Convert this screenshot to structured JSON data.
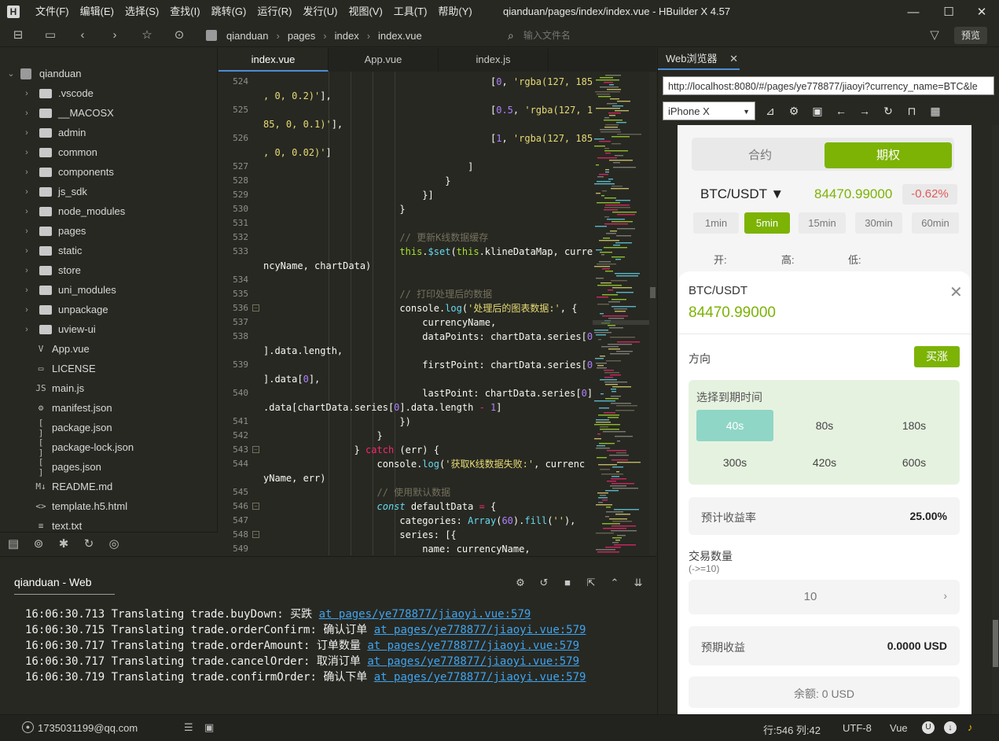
{
  "app": {
    "logo": "H",
    "title": "qianduan/pages/index/index.vue - HBuilder X 4.57",
    "menu": [
      "文件(F)",
      "编辑(E)",
      "选择(S)",
      "查找(I)",
      "跳转(G)",
      "运行(R)",
      "发行(U)",
      "视图(V)",
      "工具(T)",
      "帮助(Y)"
    ]
  },
  "toolbar": {
    "breadcrumb": [
      "qianduan",
      "pages",
      "index",
      "index.vue"
    ],
    "file_search_placeholder": "输入文件名",
    "preview_label": "预览"
  },
  "sidebar": {
    "project": "qianduan",
    "items": [
      {
        "label": ".vscode",
        "type": "folder"
      },
      {
        "label": "__MACOSX",
        "type": "folder"
      },
      {
        "label": "admin",
        "type": "folder"
      },
      {
        "label": "common",
        "type": "folder"
      },
      {
        "label": "components",
        "type": "folder"
      },
      {
        "label": "js_sdk",
        "type": "folder"
      },
      {
        "label": "node_modules",
        "type": "folder"
      },
      {
        "label": "pages",
        "type": "folder"
      },
      {
        "label": "static",
        "type": "folder"
      },
      {
        "label": "store",
        "type": "folder"
      },
      {
        "label": "uni_modules",
        "type": "folder"
      },
      {
        "label": "unpackage",
        "type": "folder"
      },
      {
        "label": "uview-ui",
        "type": "folder"
      },
      {
        "label": "App.vue",
        "type": "file",
        "icon": "V"
      },
      {
        "label": "LICENSE",
        "type": "file",
        "icon": "▭"
      },
      {
        "label": "main.js",
        "type": "file",
        "icon": "JS"
      },
      {
        "label": "manifest.json",
        "type": "file",
        "icon": "⚙"
      },
      {
        "label": "package.json",
        "type": "file",
        "icon": "[ ]"
      },
      {
        "label": "package-lock.json",
        "type": "file",
        "icon": "[ ]"
      },
      {
        "label": "pages.json",
        "type": "file",
        "icon": "[ ]"
      },
      {
        "label": "README.md",
        "type": "file",
        "icon": "M↓"
      },
      {
        "label": "template.h5.html",
        "type": "file",
        "icon": "<>"
      },
      {
        "label": "text.txt",
        "type": "file",
        "icon": "≡"
      }
    ]
  },
  "editor": {
    "tabs": [
      "index.vue",
      "App.vue",
      "index.js"
    ],
    "lines": [
      {
        "n": "524",
        "html": "                                        [<span class=\"n\">0</span>, <span class=\"s\">'rgba(127, 185</span>"
      },
      {
        "n": "",
        "html": "<span class=\"s\">, 0, 0.2)'</span>],"
      },
      {
        "n": "525",
        "html": "                                        [<span class=\"n\">0.5</span>, <span class=\"s\">'rgba(127, 1</span>"
      },
      {
        "n": "",
        "html": "<span class=\"s\">85, 0, 0.1)'</span>],"
      },
      {
        "n": "526",
        "html": "                                        [<span class=\"n\">1</span>, <span class=\"s\">'rgba(127, 185</span>"
      },
      {
        "n": "",
        "html": "<span class=\"s\">, 0, 0.02)'</span>]"
      },
      {
        "n": "527",
        "html": "                                    ]"
      },
      {
        "n": "528",
        "html": "                                }"
      },
      {
        "n": "529",
        "html": "                            }]"
      },
      {
        "n": "530",
        "html": "                        }"
      },
      {
        "n": "531",
        "html": ""
      },
      {
        "n": "532",
        "html": "                        <span class=\"c\">// 更新K线数据缓存</span>"
      },
      {
        "n": "533",
        "html": "                        <span class=\"fn\">this</span>.<span class=\"f\">$set</span>(<span class=\"fn\">this</span>.klineDataMap, curre"
      },
      {
        "n": "",
        "html": "ncyName, chartData)"
      },
      {
        "n": "534",
        "html": ""
      },
      {
        "n": "535",
        "html": "                        <span class=\"c\">// 打印处理后的数据</span>"
      },
      {
        "n": "536",
        "fold": "-",
        "html": "                        console.<span class=\"f\">log</span>(<span class=\"s\">'处理后的图表数据:'</span>, {"
      },
      {
        "n": "537",
        "html": "                            currencyName,"
      },
      {
        "n": "538",
        "html": "                            dataPoints: chartData.series[<span class=\"n\">0</span>"
      },
      {
        "n": "",
        "html": "].data.length,"
      },
      {
        "n": "539",
        "html": "                            firstPoint: chartData.series[<span class=\"n\">0</span>"
      },
      {
        "n": "",
        "html": "].data[<span class=\"n\">0</span>],"
      },
      {
        "n": "540",
        "html": "                            lastPoint: chartData.series[<span class=\"n\">0</span>]"
      },
      {
        "n": "",
        "html": ".data[chartData.series[<span class=\"n\">0</span>].data.length <span class=\"k\">-</span> <span class=\"n\">1</span>]"
      },
      {
        "n": "541",
        "html": "                        })"
      },
      {
        "n": "542",
        "html": "                    }"
      },
      {
        "n": "543",
        "fold": "-",
        "html": "                } <span class=\"k\">catch</span> (err) {"
      },
      {
        "n": "544",
        "html": "                    console.<span class=\"f\">log</span>(<span class=\"s\">'获取K线数据失败:'</span>, currenc"
      },
      {
        "n": "",
        "html": "yName, err)"
      },
      {
        "n": "545",
        "html": "                    <span class=\"c\">// 使用默认数据</span>"
      },
      {
        "n": "546",
        "fold": "-",
        "html": "                    <span class=\"kw\">const</span> defaultData <span class=\"k\">=</span> {"
      },
      {
        "n": "547",
        "html": "                        categories: <span class=\"f\">Array</span>(<span class=\"n\">60</span>).<span class=\"f\">fill</span>(<span class=\"s\">''</span>),"
      },
      {
        "n": "548",
        "fold": "-",
        "html": "                        series: [{"
      },
      {
        "n": "549",
        "html": "                            name: currencyName,"
      }
    ]
  },
  "console": {
    "tab_label": "qianduan - Web",
    "logs": [
      {
        "time": "16:06:30.713",
        "text": "Translating trade.buyDown: 买跌 ",
        "link": "at pages/ye778877/jiaoyi.vue:579"
      },
      {
        "time": "16:06:30.715",
        "text": "Translating trade.orderConfirm: 确认订单 ",
        "link": "at pages/ye778877/jiaoyi.vue:579"
      },
      {
        "time": "16:06:30.717",
        "text": "Translating trade.orderAmount: 订单数量 ",
        "link": "at pages/ye778877/jiaoyi.vue:579"
      },
      {
        "time": "16:06:30.717",
        "text": "Translating trade.cancelOrder: 取消订单 ",
        "link": "at pages/ye778877/jiaoyi.vue:579"
      },
      {
        "time": "16:06:30.719",
        "text": "Translating trade.confirmOrder: 确认下单 ",
        "link": "at pages/ye778877/jiaoyi.vue:579"
      }
    ]
  },
  "browser": {
    "tab_label": "Web浏览器",
    "url": "http://localhost:8080/#/pages/ye778877/jiaoyi?currency_name=BTC&le",
    "device": "iPhone X"
  },
  "mobile": {
    "seg_contract": "合约",
    "seg_options": "期权",
    "pair": "BTC/USDT ▼",
    "price": "84470.99000",
    "change": "-0.62%",
    "timeframes": [
      "1min",
      "5min",
      "15min",
      "30min",
      "60min"
    ],
    "ohl": [
      "开:",
      "高:",
      "低:"
    ]
  },
  "sheet": {
    "pair": "BTC/USDT",
    "price": "84470.99000",
    "direction_label": "方向",
    "direction_value": "买涨",
    "expiry_title": "选择到期时间",
    "expiry_options": [
      "40s",
      "80s",
      "180s",
      "300s",
      "420s",
      "600s"
    ],
    "rate_label": "预计收益率",
    "rate_value": "25.00%",
    "qty_label": "交易数量",
    "qty_hint": "(->=10)",
    "qty_value": "10",
    "profit_label": "预期收益",
    "profit_value": "0.0000 USD",
    "balance": "余额: 0 USD"
  },
  "statusbar": {
    "user": "1735031199@qq.com",
    "position": "行:546  列:42",
    "encoding": "UTF-8",
    "language": "Vue"
  },
  "colors": {
    "accent_green": "#7cb305",
    "selected_expiry": "#8fd6c6",
    "price_green": "#7cb305",
    "change_red": "#e05a5a",
    "link_blue": "#3fa4f0"
  }
}
